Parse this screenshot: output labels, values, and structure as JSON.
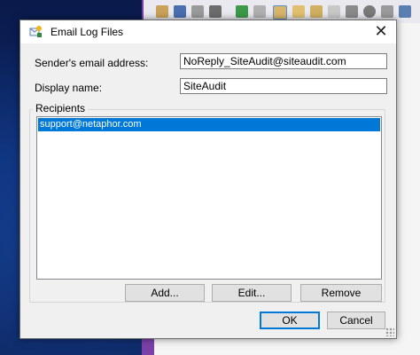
{
  "dialog": {
    "title": "Email Log Files",
    "close_symbol": "✕",
    "sender_label": "Sender's email address:",
    "sender_value": "NoReply_SiteAudit@siteaudit.com",
    "display_label": "Display name:",
    "display_value": "SiteAudit",
    "recipients_label": "Recipients",
    "recipients": [
      "support@netaphor.com"
    ],
    "add_label": "Add...",
    "edit_label": "Edit...",
    "remove_label": "Remove",
    "ok_label": "OK",
    "cancel_label": "Cancel"
  },
  "icons": {
    "title": "email-log-icon",
    "close": "close-icon"
  },
  "colors": {
    "selection": "#0078d7",
    "desktop": "#0b2a6e",
    "background_app_accent": "#7a3fa8"
  }
}
